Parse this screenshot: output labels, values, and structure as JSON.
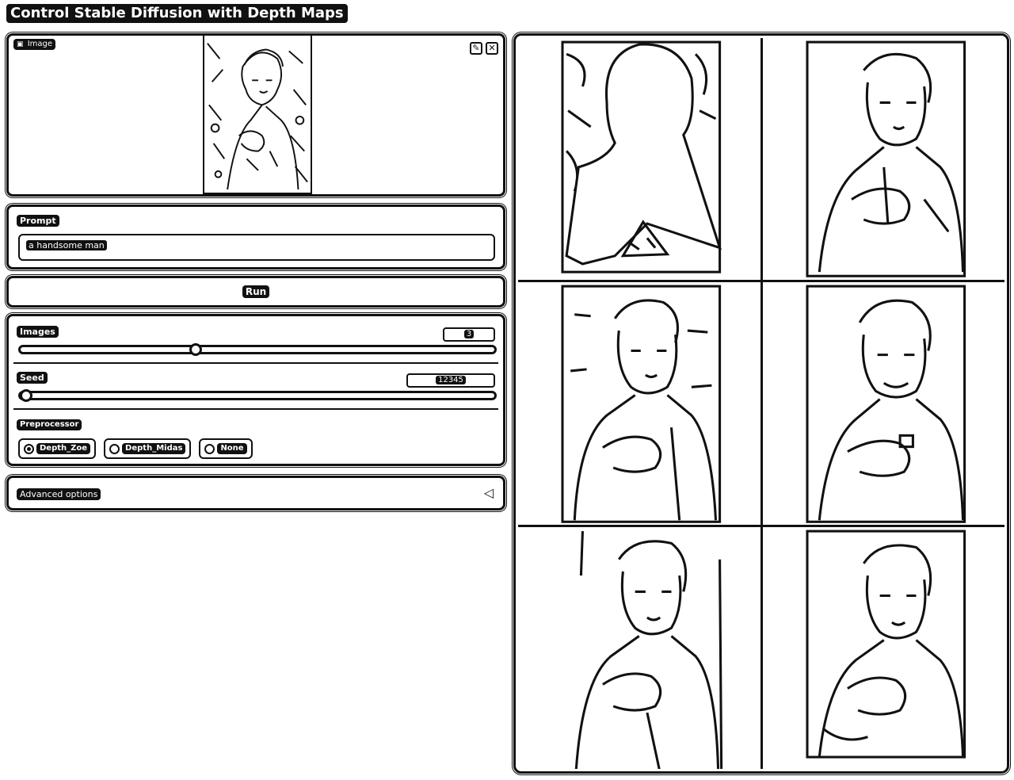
{
  "app": {
    "title": "Control Stable Diffusion with Depth Maps"
  },
  "image_input": {
    "label": "Image",
    "icon": "image-icon",
    "edit_icon": "pencil-icon",
    "clear_icon": "close-icon",
    "clear_symbol": "✕",
    "edit_symbol": "✎"
  },
  "prompt": {
    "label": "Prompt",
    "value": "a handsome man"
  },
  "run": {
    "label": "Run"
  },
  "settings": {
    "images": {
      "label": "Images",
      "value": "3",
      "min": 1,
      "max": 4,
      "fraction": 0.37
    },
    "seed": {
      "label": "Seed",
      "value": "12345",
      "fraction": 0.0
    },
    "preprocessor": {
      "label": "Preprocessor",
      "options": [
        "Depth_Zoe",
        "Depth_Midas",
        "None"
      ],
      "selected": "Depth_Zoe"
    }
  },
  "advanced": {
    "label": "Advanced options",
    "chevron": "◁"
  },
  "gallery": {
    "count": 6
  }
}
